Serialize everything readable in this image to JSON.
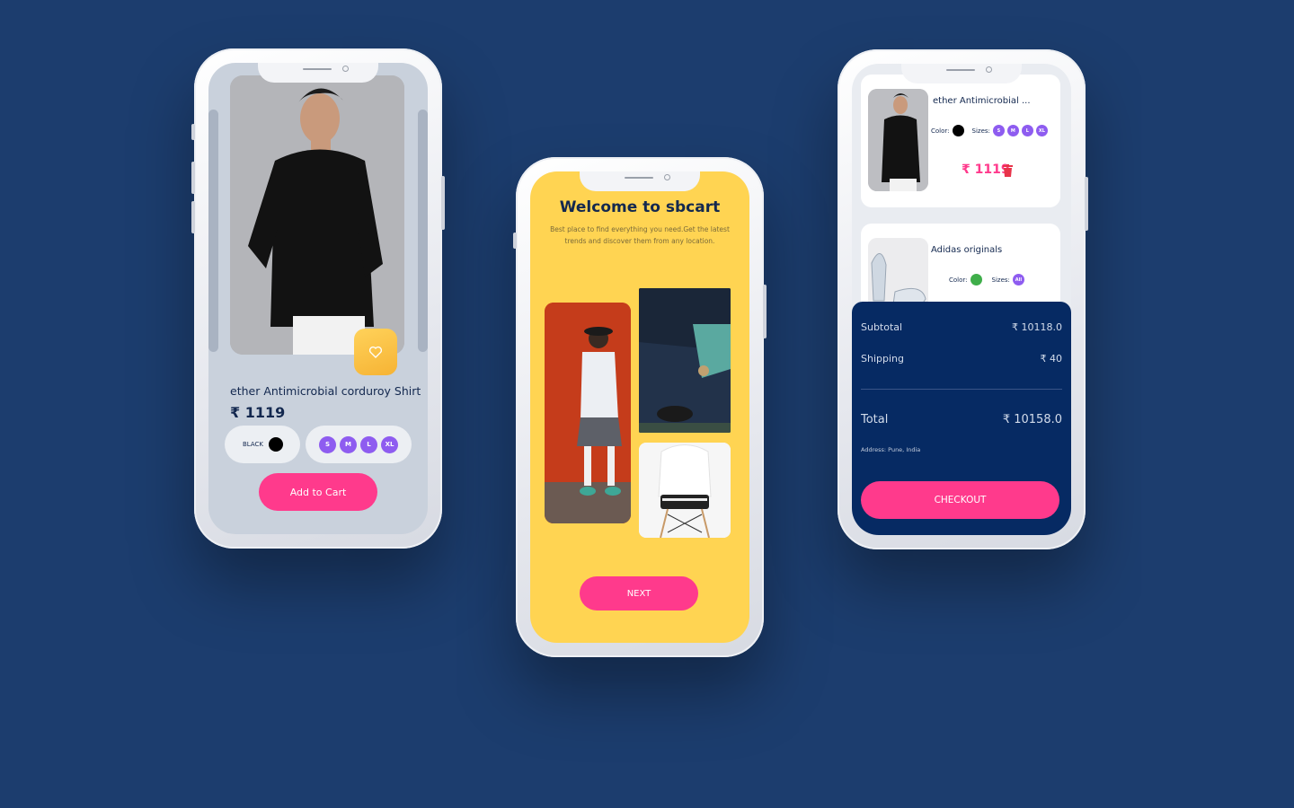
{
  "product_screen": {
    "product_title": "ether Antimicrobial corduroy Shirt",
    "product_price": "₹ 1119",
    "color_label": "BLACK",
    "color_value": "#000000",
    "sizes": [
      "S",
      "M",
      "L",
      "XL"
    ],
    "add_to_cart_label": "Add to Cart",
    "favorite_icon": "heart-icon"
  },
  "welcome_screen": {
    "title": "Welcome to sbcart",
    "subtitle": "Best place to find everything you need.Get the latest trends and discover them from any location.",
    "next_label": "NEXT"
  },
  "cart_screen": {
    "items": [
      {
        "title": "ether Antimicrobial ...",
        "color_label": "Color:",
        "color_value": "#000000",
        "sizes_label": "Sizes:",
        "sizes": [
          "S",
          "M",
          "L",
          "XL"
        ],
        "price": "₹ 1119",
        "delete_icon": "trash-icon"
      },
      {
        "title": "Adidas originals",
        "color_label": "Color:",
        "color_value": "#3fae4a",
        "sizes_label": "Sizes:",
        "sizes": [
          "All"
        ]
      }
    ],
    "summary": {
      "subtotal_label": "Subtotal",
      "subtotal_value": "₹ 10118.0",
      "shipping_label": "Shipping",
      "shipping_value": "₹ 40",
      "total_label": "Total",
      "total_value": "₹ 10158.0",
      "address": "Address: Pune, India",
      "checkout_label": "CHECKOUT"
    }
  },
  "colors": {
    "background": "#1c3d6e",
    "accent_pink": "#ff3a8c",
    "size_purple": "#8e5cf0",
    "welcome_yellow": "#ffd452",
    "summary_navy": "#062a63"
  }
}
